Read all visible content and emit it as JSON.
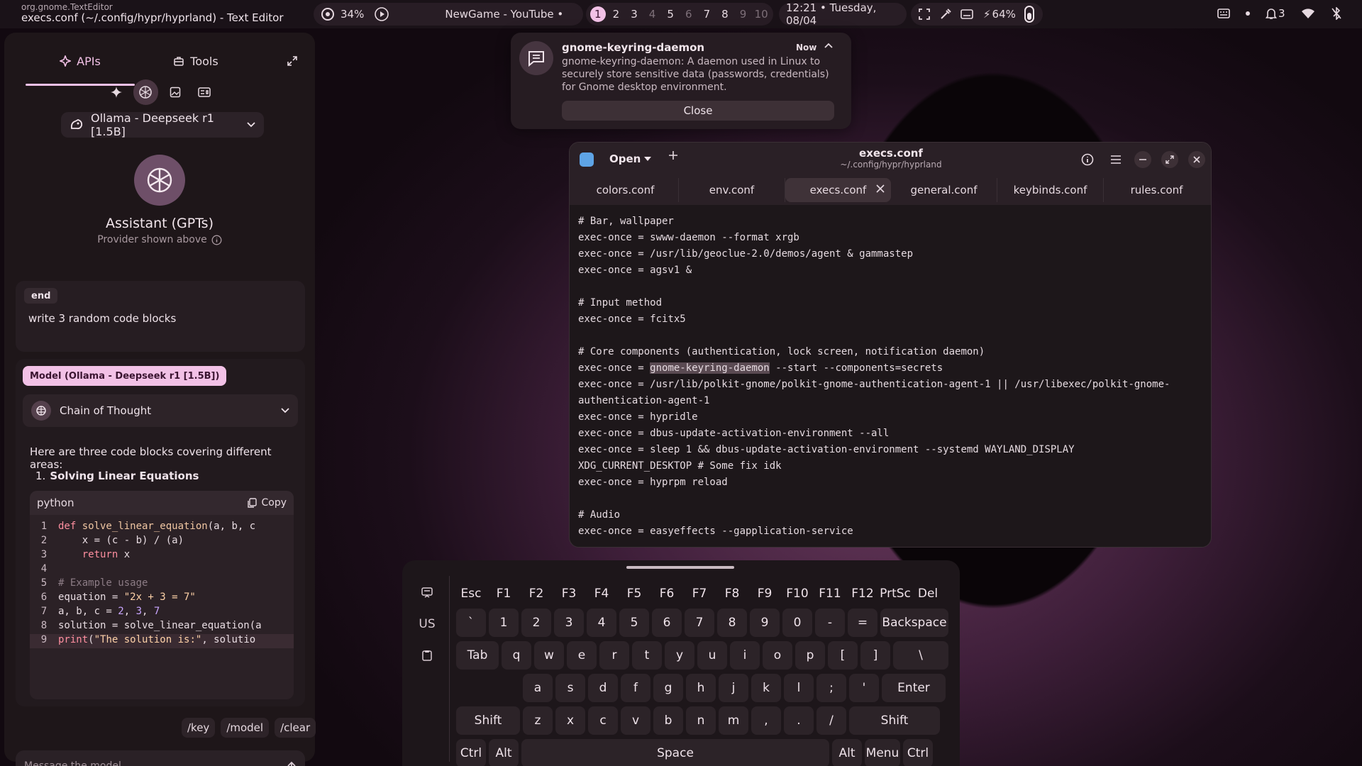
{
  "window": {
    "class": "org.gnome.TextEditor",
    "title": "execs.conf (~/.config/hypr/hyprland) - Text Editor"
  },
  "topbar": {
    "cpu": "34%",
    "media_title": "NewGame - YouTube •",
    "workspaces": [
      "1",
      "2",
      "3",
      "4",
      "5",
      "6",
      "7",
      "8",
      "9",
      "10"
    ],
    "active_workspace": "1",
    "datetime": "12:21 • Tuesday, 08/04",
    "battery": "64%",
    "notif_count": "3"
  },
  "sidebar": {
    "tabs": [
      {
        "label": "APIs"
      },
      {
        "label": "Tools"
      }
    ],
    "model_selector": "Ollama - Deepseek r1 [1.5B]",
    "assistant_title": "Assistant (GPTs)",
    "assistant_subtitle": "Provider shown above",
    "user_msg": {
      "badge": "end",
      "text": "write 3 random code blocks"
    },
    "model_msg": {
      "badge": "Model (Ollama - Deepseek r1 [1.5B])",
      "cot": "Chain of Thought",
      "intro": "Here are three code blocks covering different areas:",
      "list_num": "1.",
      "list_title": "Solving Linear Equations",
      "code_lang": "python",
      "copy": "Copy"
    },
    "chips": [
      "/key",
      "/model",
      "/clear"
    ],
    "compose_placeholder": "Message the model..."
  },
  "notification": {
    "title": "gnome-keyring-daemon",
    "time": "Now",
    "body": "gnome-keyring-daemon: A daemon used in Linux to securely store sensitive data (passwords, credentials) for Gnome desktop environment.",
    "close": "Close"
  },
  "editor": {
    "open": "Open",
    "title": "execs.conf",
    "path": "~/.config/hypr/hyprland",
    "tabs": [
      "colors.conf",
      "env.conf",
      "execs.conf",
      "general.conf",
      "keybinds.conf",
      "rules.conf"
    ],
    "active_tab": 2,
    "lines": [
      "# Bar, wallpaper",
      "exec-once = swww-daemon --format xrgb",
      "exec-once = /usr/lib/geoclue-2.0/demos/agent & gammastep",
      "exec-once = agsv1 &",
      "",
      "# Input method",
      "exec-once = fcitx5",
      "",
      "# Core components (authentication, lock screen, notification daemon)",
      "exec-once = [[gnome-keyring-daemon]] --start --components=secrets",
      "exec-once = /usr/lib/polkit-gnome/polkit-gnome-authentication-agent-1 || /usr/libexec/polkit-gnome-",
      "authentication-agent-1",
      "exec-once = hypridle",
      "exec-once = dbus-update-activation-environment --all",
      "exec-once = sleep 1 && dbus-update-activation-environment --systemd WAYLAND_DISPLAY",
      "XDG_CURRENT_DESKTOP # Some fix idk",
      "exec-once = hyprpm reload",
      "",
      "# Audio",
      "exec-once = easyeffects --gapplication-service"
    ]
  },
  "keyboard": {
    "layout": "US",
    "rows": [
      [
        "Esc",
        "F1",
        "F2",
        "F3",
        "F4",
        "F5",
        "F6",
        "F7",
        "F8",
        "F9",
        "F10",
        "F11",
        "F12",
        "PrtSc",
        "Del"
      ],
      [
        "`",
        "1",
        "2",
        "3",
        "4",
        "5",
        "6",
        "7",
        "8",
        "9",
        "0",
        "-",
        "=",
        "Backspace"
      ],
      [
        "Tab",
        "q",
        "w",
        "e",
        "r",
        "t",
        "y",
        "u",
        "i",
        "o",
        "p",
        "[",
        "]",
        "\\"
      ],
      [
        "",
        "a",
        "s",
        "d",
        "f",
        "g",
        "h",
        "j",
        "k",
        "l",
        ";",
        "'",
        "Enter"
      ],
      [
        "Shift",
        "z",
        "x",
        "c",
        "v",
        "b",
        "n",
        "m",
        ",",
        ".",
        "/",
        "Shift"
      ],
      [
        "Ctrl",
        "Alt",
        "Space",
        "Alt",
        "Menu",
        "Ctrl"
      ]
    ]
  },
  "code_block": [
    [
      [
        "k",
        "def "
      ],
      [
        "f",
        "solve_linear_equation"
      ],
      [
        "",
        "(a, b, c"
      ]
    ],
    [
      [
        "",
        "    x = (c - b) / (a)"
      ]
    ],
    [
      [
        "",
        "    "
      ],
      [
        "k",
        "return"
      ],
      [
        "",
        " x"
      ]
    ],
    [
      [
        "",
        ""
      ]
    ],
    [
      [
        "c",
        "# Example usage"
      ]
    ],
    [
      [
        "",
        "equation = "
      ],
      [
        "s",
        "\"2x + 3 = 7\""
      ]
    ],
    [
      [
        "",
        "a, b, c = "
      ],
      [
        "n",
        "2"
      ],
      [
        "",
        ", "
      ],
      [
        "n",
        "3"
      ],
      [
        "",
        ", "
      ],
      [
        "n",
        "7"
      ]
    ],
    [
      [
        "",
        "solution = solve_linear_equation(a"
      ]
    ],
    [
      [
        "k",
        "print"
      ],
      [
        "",
        "("
      ],
      [
        "s",
        "\"The solution is:\""
      ],
      [
        "",
        ", solutio"
      ]
    ]
  ],
  "colors": {
    "accent": "#f2c1e6",
    "panel": "#1e1619",
    "editor_bg": "#1d171a"
  }
}
